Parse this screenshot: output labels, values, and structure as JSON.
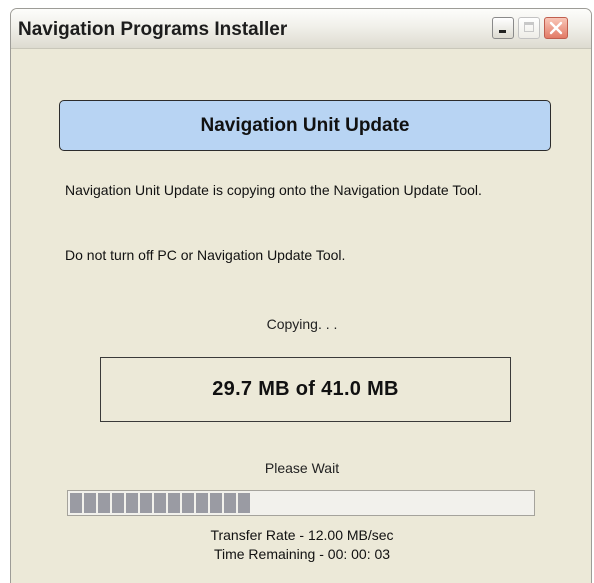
{
  "window": {
    "title": "Navigation Programs Installer",
    "controls": [
      "minimize",
      "maximize",
      "close"
    ]
  },
  "header": {
    "title": "Navigation Unit Update"
  },
  "body": {
    "message": "Navigation Unit Update is copying onto the Navigation Update Tool.",
    "warning": "Do not turn off PC or Navigation Update Tool."
  },
  "status": {
    "copying_label": "Copying. . .",
    "size_text": "29.7 MB of 41.0 MB",
    "wait_label": "Please Wait",
    "progress_fraction": 0.39,
    "progress_color": "#9a9ba3",
    "transfer_rate": "Transfer Rate - 12.00 MB/sec",
    "time_remaining": "Time Remaining - 00: 00: 03"
  },
  "colors": {
    "header_fill": "#b8d4f3",
    "window_bg": "#ece9d8",
    "close_button": "#e27a66"
  }
}
